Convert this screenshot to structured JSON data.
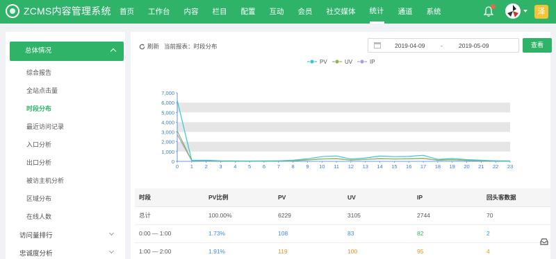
{
  "app": {
    "title": "ZCMS内容管理系统"
  },
  "nav": [
    {
      "label": "首页",
      "active": false
    },
    {
      "label": "工作台",
      "active": false
    },
    {
      "label": "内容",
      "active": false
    },
    {
      "label": "栏目",
      "active": false
    },
    {
      "label": "配置",
      "active": false
    },
    {
      "label": "互动",
      "active": false
    },
    {
      "label": "会员",
      "active": false
    },
    {
      "label": "社交媒体",
      "active": false
    },
    {
      "label": "统计",
      "active": true
    },
    {
      "label": "通道",
      "active": false
    },
    {
      "label": "系统",
      "active": false
    }
  ],
  "header": {
    "user_initial": "泽",
    "bell_icon": "bell-icon",
    "accent": "#2eb369"
  },
  "sidebar": {
    "group_label": "总体情况",
    "sub_items": [
      {
        "label": "综合报告",
        "active": false
      },
      {
        "label": "全站点击量",
        "active": false
      },
      {
        "label": "时段分布",
        "active": true
      },
      {
        "label": "最近访问记录",
        "active": false
      },
      {
        "label": "入口分析",
        "active": false
      },
      {
        "label": "出口分析",
        "active": false
      },
      {
        "label": "被访主机分析",
        "active": false
      },
      {
        "label": "区域分布",
        "active": false
      },
      {
        "label": "在线人数",
        "active": false
      }
    ],
    "top_items": [
      {
        "label": "访问量排行"
      },
      {
        "label": "忠诚度分析"
      }
    ]
  },
  "toolbar": {
    "refresh_label": "刷新",
    "report_label": "当前报表：时段分布",
    "date_start": "2019-04-09",
    "date_sep": "-",
    "date_end": "2019-05-09",
    "view_label": "查看"
  },
  "chart_data": {
    "type": "line",
    "x": [
      0,
      1,
      2,
      3,
      4,
      5,
      6,
      7,
      8,
      9,
      10,
      11,
      12,
      13,
      14,
      15,
      16,
      17,
      18,
      19,
      20,
      21,
      22,
      23
    ],
    "ylim": [
      0,
      7000
    ],
    "yticks": [
      "7,000",
      "6,000",
      "5,000",
      "4,000",
      "3,000",
      "2,000",
      "1,000",
      "0"
    ],
    "grid": true,
    "legend_position": "top",
    "series": [
      {
        "name": "PV",
        "color": "#36c6d3",
        "values": [
          6229,
          108,
          119,
          60,
          40,
          35,
          40,
          60,
          120,
          260,
          480,
          550,
          230,
          350,
          540,
          480,
          500,
          620,
          200,
          280,
          180,
          120,
          60,
          40
        ]
      },
      {
        "name": "UV",
        "color": "#8fb356",
        "values": [
          3105,
          83,
          100,
          40,
          30,
          25,
          30,
          40,
          70,
          150,
          250,
          280,
          130,
          200,
          280,
          250,
          270,
          310,
          120,
          160,
          100,
          70,
          40,
          30
        ]
      },
      {
        "name": "IP",
        "color": "#a99ae0",
        "values": [
          2744,
          82,
          95,
          38,
          28,
          22,
          28,
          38,
          65,
          140,
          230,
          260,
          120,
          190,
          260,
          230,
          250,
          290,
          110,
          150,
          95,
          65,
          38,
          28
        ]
      }
    ]
  },
  "table": {
    "headers": [
      "时段",
      "PV比例",
      "PV",
      "UV",
      "IP",
      "回头客数据"
    ],
    "rows": [
      [
        "总计",
        "100.00%",
        "6229",
        "3105",
        "2744",
        "70"
      ],
      [
        "0:00 — 1:00",
        "1.73%",
        "108",
        "83",
        "82",
        "2"
      ],
      [
        "1:00 — 2:00",
        "1.91%",
        "119",
        "100",
        "95",
        "4"
      ]
    ]
  }
}
